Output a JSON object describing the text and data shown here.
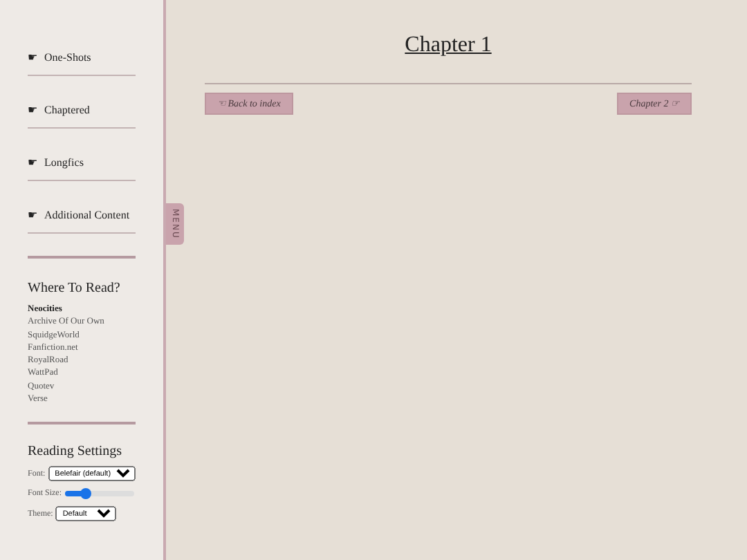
{
  "sidebar": {
    "nav_items": [
      {
        "icon": "☛",
        "label": "One-Shots"
      },
      {
        "icon": "☛",
        "label": "Chaptered"
      },
      {
        "icon": "☛",
        "label": "Longfics"
      },
      {
        "icon": "☛",
        "label": "Additional Content"
      }
    ],
    "where_to_read": {
      "title": "Where To Read?",
      "sites": [
        {
          "label": "Neocities",
          "selected": true
        },
        {
          "label": "Archive Of Our Own",
          "selected": false
        },
        {
          "label": "SquidgeWorld",
          "selected": false
        },
        {
          "label": "Fanfiction.net",
          "selected": false
        },
        {
          "label": "RoyalRoad",
          "selected": false
        },
        {
          "label": "WattPad",
          "selected": false
        },
        {
          "label": "Quotev",
          "selected": false
        },
        {
          "label": "Verse",
          "selected": false
        }
      ]
    },
    "reading_settings": {
      "title": "Reading Settings",
      "font": {
        "label": "Font:",
        "value": "Belefair (default)"
      },
      "font_size": {
        "label": "Font Size:",
        "level": 0.3
      },
      "theme": {
        "label": "Theme:",
        "value": "Default"
      }
    }
  },
  "menu_tab": "MENU",
  "main": {
    "title": "Chapter 1",
    "back_button": "☜ Back to index",
    "next_button": "Chapter 2 ☞"
  }
}
